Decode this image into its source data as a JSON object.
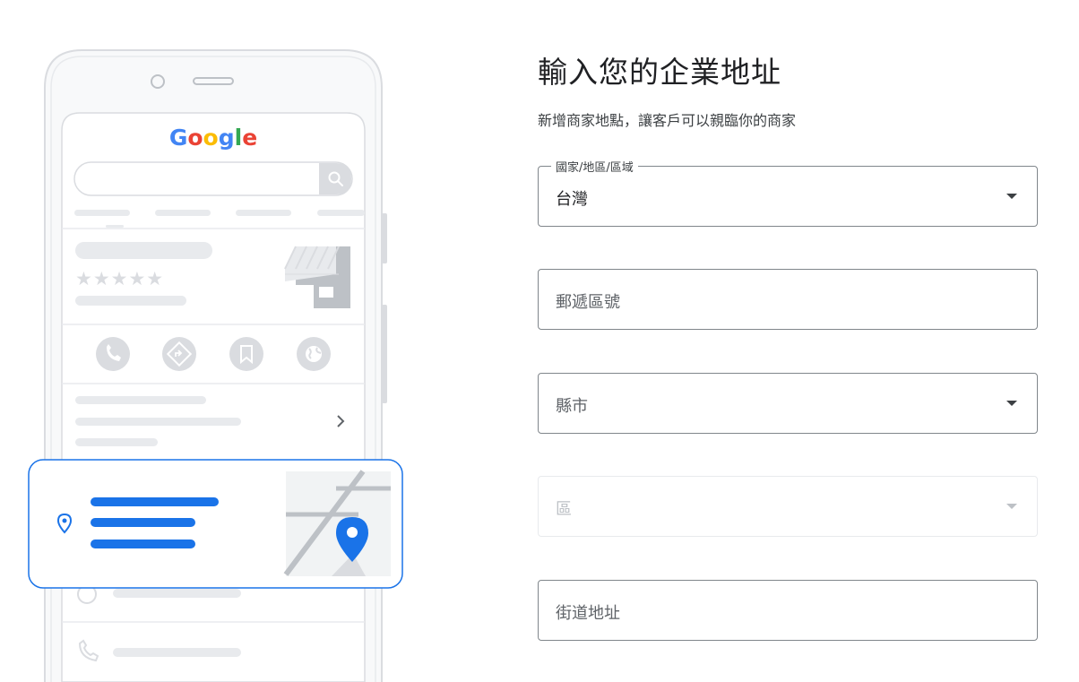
{
  "illustration": {
    "google_logo": {
      "letters": [
        {
          "ch": "G",
          "color": "#4285F4"
        },
        {
          "ch": "o",
          "color": "#EA4335"
        },
        {
          "ch": "o",
          "color": "#FBBC05"
        },
        {
          "ch": "g",
          "color": "#4285F4"
        },
        {
          "ch": "l",
          "color": "#34A853"
        },
        {
          "ch": "e",
          "color": "#EA4335"
        }
      ]
    },
    "stars": "★★★★★",
    "accent_color": "#1a73e8"
  },
  "form": {
    "title": "輸入您的企業地址",
    "subtitle": "新增商家地點，讓客戶可以親臨你的商家",
    "country": {
      "label": "國家/地區/區域",
      "value": "台灣"
    },
    "postal": {
      "placeholder": "郵遞區號"
    },
    "city": {
      "placeholder": "縣市"
    },
    "district": {
      "placeholder": "區"
    },
    "street": {
      "placeholder": "街道地址"
    }
  }
}
